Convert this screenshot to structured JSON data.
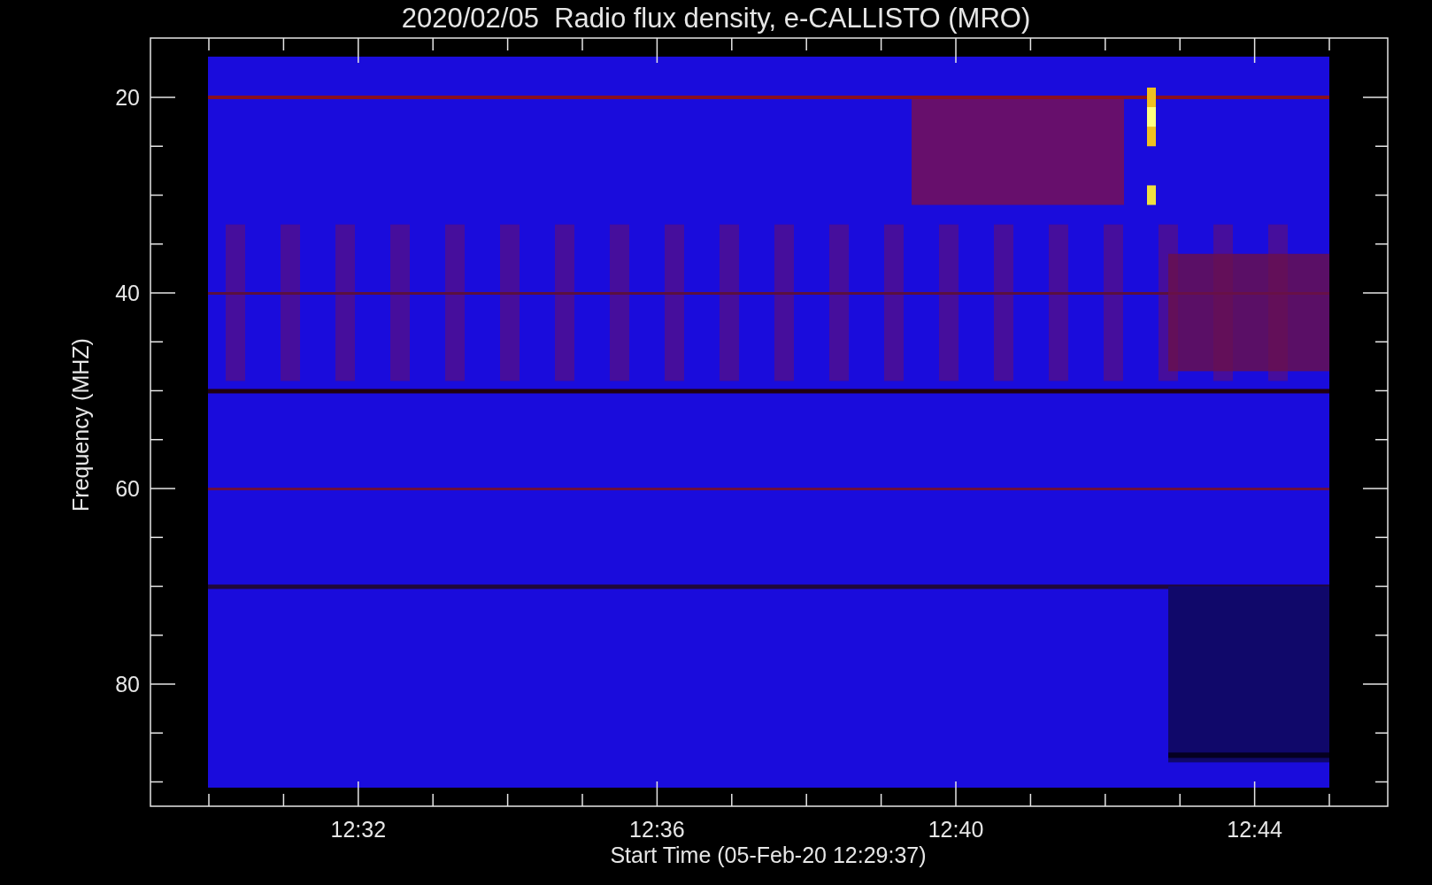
{
  "title": "2020/02/05  Radio flux density, e-CALLISTO (MRO)",
  "y_axis": {
    "label": "Frequency (MHZ)",
    "ticks": [
      "20",
      "40",
      "60",
      "80"
    ]
  },
  "x_axis": {
    "label": "Start Time (05-Feb-20 12:29:37)",
    "ticks": [
      "12:32",
      "12:36",
      "12:40",
      "12:44"
    ]
  }
}
